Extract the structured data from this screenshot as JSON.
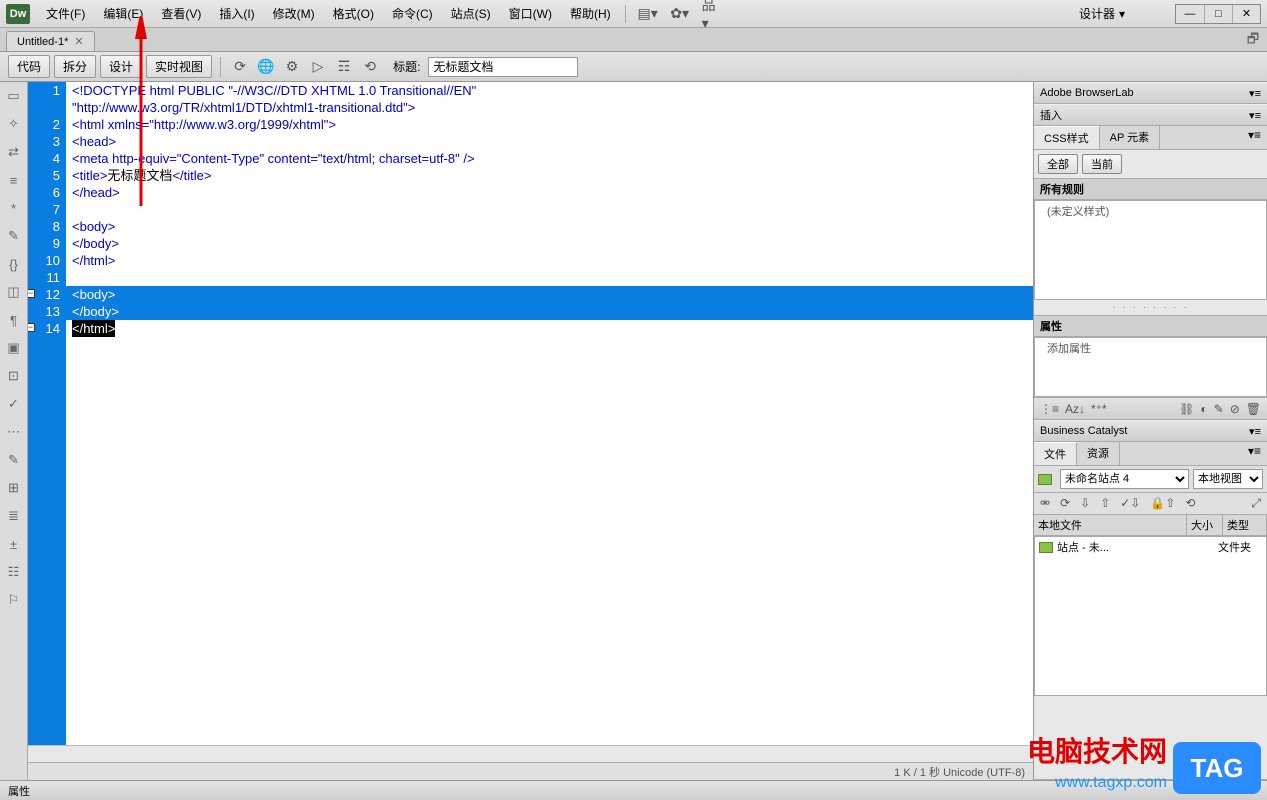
{
  "app": {
    "logo": "Dw",
    "designer_label": "设计器"
  },
  "menu": [
    "文件(F)",
    "编辑(E)",
    "查看(V)",
    "插入(I)",
    "修改(M)",
    "格式(O)",
    "命令(C)",
    "站点(S)",
    "窗口(W)",
    "帮助(H)"
  ],
  "doc_tab": {
    "name": "Untitled-1*"
  },
  "toolbar": {
    "code": "代码",
    "split": "拆分",
    "design": "设计",
    "live": "实时视图",
    "title_label": "标题:",
    "title_value": "无标题文档"
  },
  "code_lines": [
    {
      "n": 1,
      "cls": "kw",
      "t": "<!DOCTYPE html PUBLIC \"-//W3C//DTD XHTML 1.0 Transitional//EN\""
    },
    {
      "n": 0,
      "cls": "kw",
      "t": "\"http://www.w3.org/TR/xhtml1/DTD/xhtml1-transitional.dtd\">"
    },
    {
      "n": 2,
      "cls": "kw",
      "t": "<html xmlns=\"http://www.w3.org/1999/xhtml\">"
    },
    {
      "n": 3,
      "cls": "kw",
      "t": "<head>"
    },
    {
      "n": 4,
      "cls": "kw",
      "t": "<meta http-equiv=\"Content-Type\" content=\"text/html; charset=utf-8\" />"
    },
    {
      "n": 5,
      "cls": "mix",
      "pre": "<title>",
      "mid": "无标题文档",
      "post": "</title>"
    },
    {
      "n": 6,
      "cls": "kw",
      "t": "</head>"
    },
    {
      "n": 7,
      "cls": "",
      "t": ""
    },
    {
      "n": 8,
      "cls": "kw",
      "t": "<body>"
    },
    {
      "n": 9,
      "cls": "kw",
      "t": "</body>"
    },
    {
      "n": 10,
      "cls": "kw",
      "t": "</html>"
    },
    {
      "n": 11,
      "cls": "",
      "t": ""
    },
    {
      "n": 12,
      "cls": "sel",
      "t": "<body>",
      "fold": true
    },
    {
      "n": 13,
      "cls": "sel",
      "t": "</body>"
    },
    {
      "n": 14,
      "cls": "selend",
      "t": "</html>",
      "fold": true
    }
  ],
  "status": "1 K / 1 秒 Unicode (UTF-8)",
  "panels": {
    "browserlab": "Adobe BrowserLab",
    "insert": "插入",
    "css_tab": "CSS样式",
    "ap_tab": "AP 元素",
    "btn_all": "全部",
    "btn_current": "当前",
    "rules_head": "所有规则",
    "rules_empty": "(未定义样式)",
    "props_head": "属性",
    "props_add": "添加属性",
    "business": "Business Catalyst",
    "files_tab": "文件",
    "assets_tab": "资源",
    "site_name": "未命名站点 4",
    "view_name": "本地视图",
    "col_local": "本地文件",
    "col_size": "大小",
    "col_type": "类型",
    "row_name": "站点 - 未...",
    "row_type": "文件夹"
  },
  "bottom": {
    "props": "属性"
  },
  "watermark": {
    "text1": "电脑技术网",
    "text2": "www.tagxp.com",
    "badge": "TAG"
  }
}
